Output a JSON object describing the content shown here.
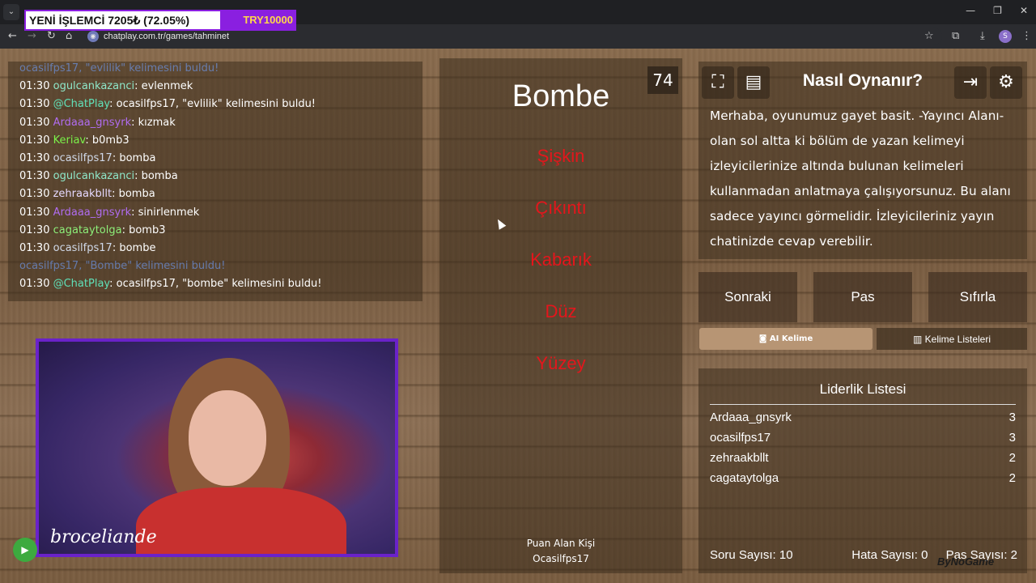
{
  "banner": {
    "text": "YENİ İŞLEMCİ  7205₺ (72.05%)",
    "goal": "TRY10000"
  },
  "browser": {
    "url": "chatplay.com.tr/games/tahminet",
    "profile_initial": "S"
  },
  "chat": {
    "lines": [
      {
        "time": "",
        "user": "ocasilfps17, \"evlilik\" kelimesini buldu!",
        "user_color": "#6fa0ff",
        "msg": "",
        "faded": true
      },
      {
        "time": "01:30",
        "user": "ogulcankazanci",
        "user_color": "#8ee6c8",
        "msg": ": evlenmek"
      },
      {
        "time": "01:30",
        "user": "@ChatPlay",
        "user_color": "#5fe0b8",
        "msg": ": ocasilfps17, \"evlilik\" kelimesini buldu!"
      },
      {
        "time": "01:30",
        "user": "Ardaaa_gnsyrk",
        "user_color": "#b06cf0",
        "msg": ": kızmak"
      },
      {
        "time": "01:30",
        "user": "Keriav",
        "user_color": "#7cf24a",
        "msg": ": b0mb3"
      },
      {
        "time": "01:30",
        "user": "ocasilfps17",
        "user_color": "#cfd8e8",
        "msg": ": bomba"
      },
      {
        "time": "01:30",
        "user": "ogulcankazanci",
        "user_color": "#8ee6c8",
        "msg": ": bomba"
      },
      {
        "time": "01:30",
        "user": "zehraakbllt",
        "user_color": "#e6d9ff",
        "msg": ": bomba"
      },
      {
        "time": "01:30",
        "user": "Ardaaa_gnsyrk",
        "user_color": "#b06cf0",
        "msg": ": sinirlenmek"
      },
      {
        "time": "01:30",
        "user": "cagataytolga",
        "user_color": "#8ef07a",
        "msg": ": bomb3"
      },
      {
        "time": "01:30",
        "user": "ocasilfps17",
        "user_color": "#cfd8e8",
        "msg": ": bombe"
      },
      {
        "time": "",
        "user": "ocasilfps17, \"Bombe\" kelimesini buldu!",
        "user_color": "#6fa0ff",
        "msg": "",
        "faded": true
      },
      {
        "time": "01:30",
        "user": "@ChatPlay",
        "user_color": "#5fe0b8",
        "msg": ": ocasilfps17, \"bombe\" kelimesini buldu!"
      }
    ]
  },
  "webcam": {
    "name": "broceliande"
  },
  "game": {
    "timer": "74",
    "word": "Bombe",
    "forbidden": [
      "Şişkin",
      "Çıkıntı",
      "Kabarık",
      "Düz",
      "Yüzey"
    ],
    "scorer_label": "Puan Alan Kişi",
    "scorer_name": "Ocasilfps17"
  },
  "howto": {
    "title": "Nasıl Oynanır?",
    "text": "Merhaba, oyunumuz gayet basit. -Yayıncı Alanı- olan sol altta ki bölüm de yazan kelimeyi izleyicilerinize altında bulunan kelimeleri kullanmadan anlatmaya çalışıyorsunuz. Bu alanı sadece yayıncı görmelidir. İzleyicileriniz yayın chatinizde cevap verebilir."
  },
  "controls": {
    "next": "Sonraki",
    "pass": "Pas",
    "reset": "Sıfırla",
    "ai_word": "AI Kelime",
    "word_lists": "Kelime Listeleri"
  },
  "leaderboard": {
    "title": "Liderlik Listesi",
    "rows": [
      {
        "name": "Ardaaa_gnsyrk",
        "score": "3"
      },
      {
        "name": "ocasilfps17",
        "score": "3"
      },
      {
        "name": "zehraakbllt",
        "score": "2"
      },
      {
        "name": "cagataytolga",
        "score": "2"
      }
    ],
    "question_count": "Soru Sayısı: 10",
    "error_count": "Hata Sayısı: 0",
    "pass_count": "Pas Sayısı: 2"
  },
  "logo": "ByNoGame"
}
